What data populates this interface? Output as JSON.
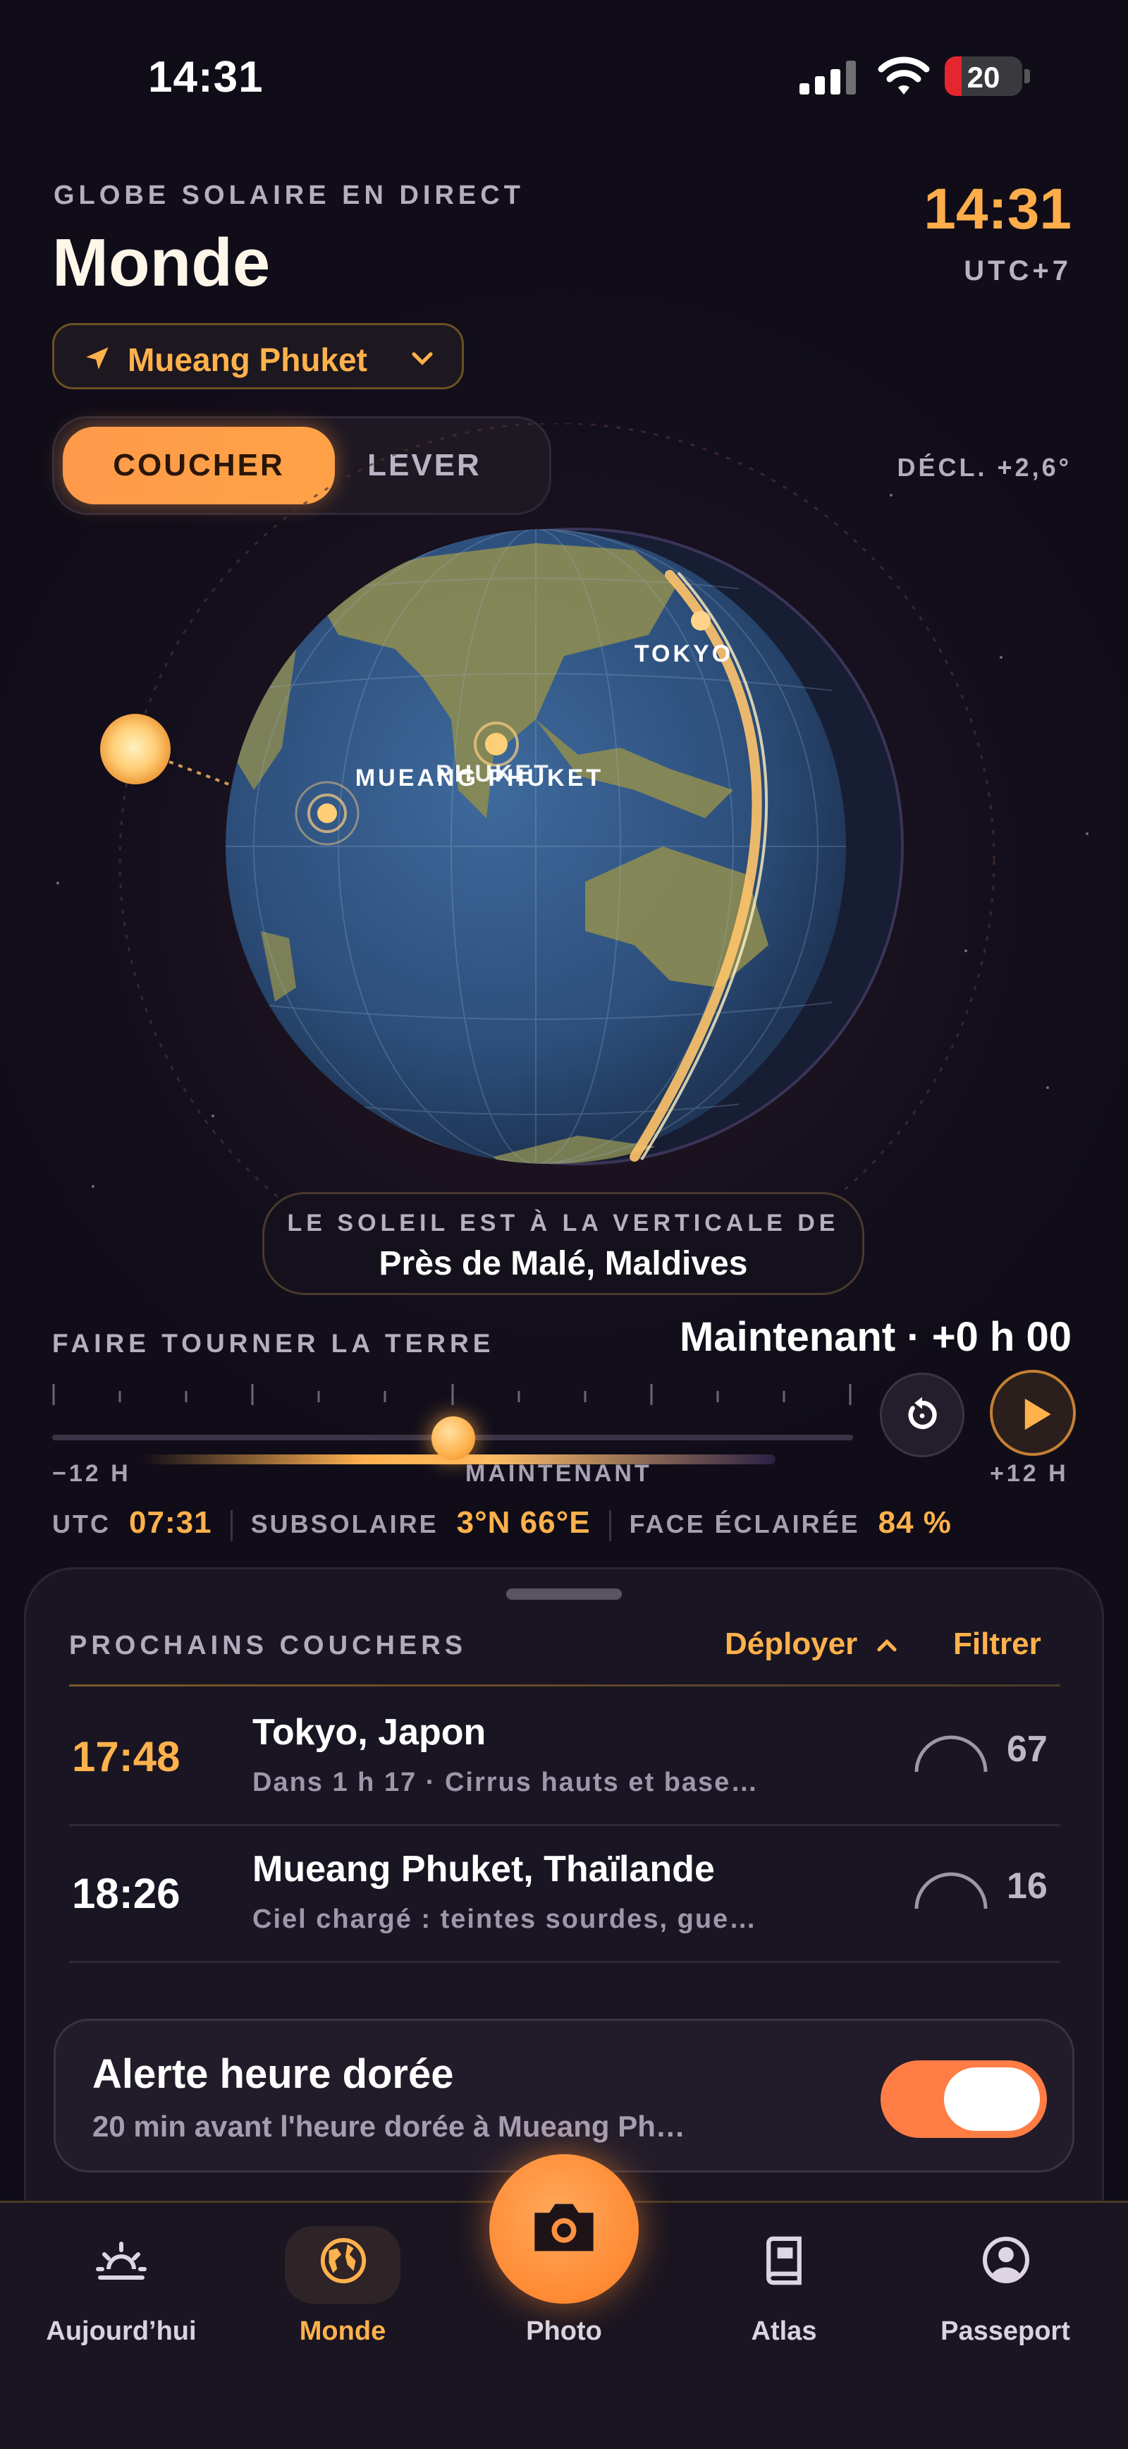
{
  "status_bar": {
    "time": "14:31",
    "battery": "20"
  },
  "header": {
    "eyebrow": "GLOBE SOLAIRE EN DIRECT",
    "title": "Monde",
    "local_time": "14:31",
    "timezone": "UTC+7",
    "location": "Mueang Phuket"
  },
  "mode_toggle": {
    "active": "COUCHER",
    "inactive": "LEVER"
  },
  "declination": "DÉCL. +2,6°",
  "globe": {
    "markers": [
      "TOKYO",
      "PHUKET",
      "MUEANG PHUKET"
    ],
    "subsolar_caption": "LE SOLEIL EST À LA VERTICALE DE",
    "subsolar_place": "Près de Malé, Maldives"
  },
  "rotation": {
    "label": "FAIRE TOURNER LA TERRE",
    "current": "Maintenant · +0 h 00",
    "min_label": "−12 H",
    "mid_label": "MAINTENANT",
    "max_label": "+12 H",
    "offset_hours": 0
  },
  "stats": {
    "utc_label": "UTC",
    "utc_value": "07:31",
    "subsolar_label": "SUBSOLAIRE",
    "subsolar_value": "3°N 66°E",
    "lit_label": "FACE ÉCLAIRÉE",
    "lit_value": "84 %"
  },
  "sunsets": {
    "title": "PROCHAINS COUCHERS",
    "expand": "Déployer",
    "filter": "Filtrer",
    "rows": [
      {
        "time": "17:48",
        "place": "Tokyo, Japon",
        "detail": "Dans 1 h 17 · Cirrus hauts et base…",
        "score": "67",
        "highlight": true
      },
      {
        "time": "18:26",
        "place": "Mueang Phuket, Thaïlande",
        "detail": "Ciel chargé : teintes sourdes, gue…",
        "score": "16",
        "highlight": false
      }
    ]
  },
  "alert": {
    "title": "Alerte heure dorée",
    "subtitle": "20 min avant l'heure dorée à Mueang Ph…",
    "enabled": true
  },
  "tabbar": {
    "items": [
      {
        "label": "Aujourd’hui",
        "icon": "sunrise-icon",
        "active": false
      },
      {
        "label": "Monde",
        "icon": "globe-icon",
        "active": true
      },
      {
        "label": "Photo",
        "icon": "camera-icon",
        "active": false
      },
      {
        "label": "Atlas",
        "icon": "book-icon",
        "active": false
      },
      {
        "label": "Passeport",
        "icon": "person-icon",
        "active": false
      }
    ]
  },
  "colors": {
    "accent": "#FFAD4A",
    "toggle_on": "#FF7D45",
    "background": "#130F1D"
  }
}
